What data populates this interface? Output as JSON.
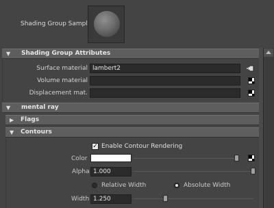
{
  "sample": {
    "label": "Shading Group Sample",
    "icon": "shaded-sphere-preview"
  },
  "sections": {
    "sg_attributes": {
      "title": "Shading Group Attributes",
      "expanded": true,
      "rows": {
        "surface": {
          "label": "Surface material",
          "value": "lambert2",
          "button_icon": "navigate-output-icon"
        },
        "volume": {
          "label": "Volume material",
          "value": "",
          "button_icon": "checker-map-icon"
        },
        "displacement": {
          "label": "Displacement mat.",
          "value": "",
          "button_icon": "checker-map-icon"
        }
      }
    },
    "mental_ray": {
      "title": "mental ray",
      "expanded": true
    },
    "flags": {
      "title": "Flags",
      "expanded": false
    },
    "contours": {
      "title": "Contours",
      "expanded": true,
      "enable": {
        "label": "Enable Contour Rendering",
        "checked": true
      },
      "color": {
        "label": "Color",
        "value": "#ffffff",
        "slider": 0.97
      },
      "alpha": {
        "label": "Alpha",
        "value": "1.000",
        "slider": 1.0
      },
      "width_mode": {
        "relative": "Relative Width",
        "absolute": "Absolute Width",
        "selected": "absolute"
      },
      "width": {
        "label": "Width",
        "value": "1.250",
        "slider": 0.25
      }
    }
  }
}
